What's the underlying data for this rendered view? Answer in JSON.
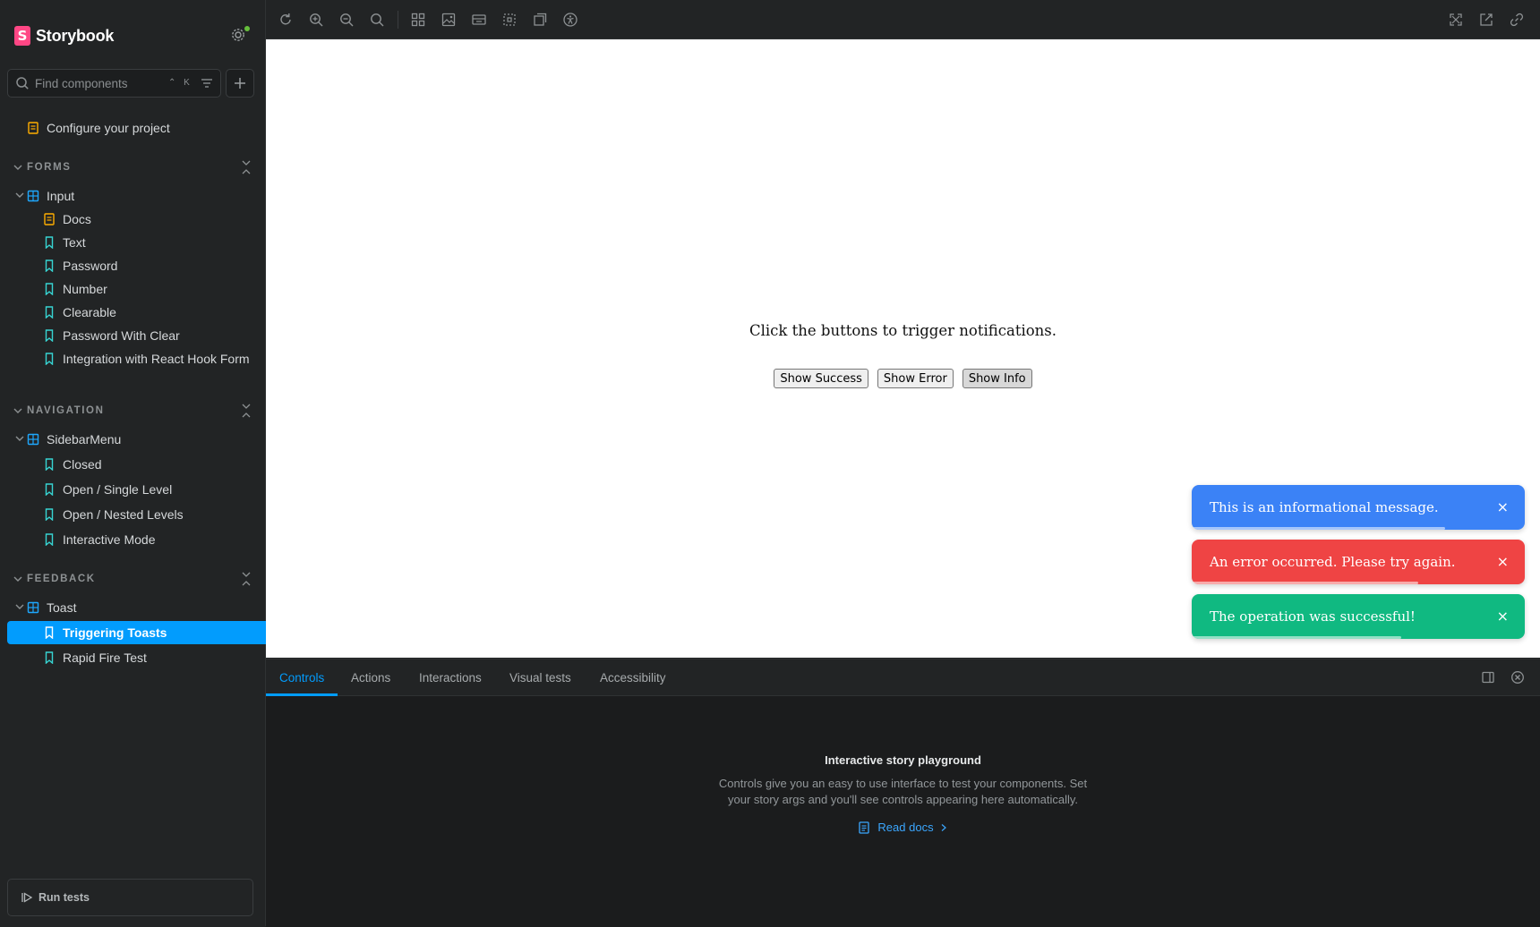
{
  "app": {
    "name": "Storybook"
  },
  "search": {
    "placeholder": "Find components",
    "shortcut": "⌃ K"
  },
  "sidebar": {
    "configure": "Configure your project",
    "sections": [
      {
        "title": "FORMS",
        "component": "Input",
        "items": [
          "Docs",
          "Text",
          "Password",
          "Number",
          "Clearable",
          "Password With Clear",
          "Integration with React Hook Form"
        ]
      },
      {
        "title": "NAVIGATION",
        "component": "SidebarMenu",
        "items": [
          "Closed",
          "Open / Single Level",
          "Open / Nested Levels",
          "Interactive Mode"
        ]
      },
      {
        "title": "FEEDBACK",
        "component": "Toast",
        "items": [
          "Triggering Toasts",
          "Rapid Fire Test"
        ]
      }
    ],
    "run_tests": "Run tests"
  },
  "preview": {
    "prompt": "Click the buttons to trigger notifications.",
    "buttons": [
      "Show Success",
      "Show Error",
      "Show Info"
    ],
    "toasts": [
      {
        "type": "info",
        "message": "This is an informational message.",
        "close": "×",
        "progress": 0.76
      },
      {
        "type": "error",
        "message": "An error occurred. Please try again.",
        "close": "×",
        "progress": 0.68
      },
      {
        "type": "success",
        "message": "The operation was successful!",
        "close": "×",
        "progress": 0.63
      }
    ]
  },
  "panel": {
    "tabs": [
      "Controls",
      "Actions",
      "Interactions",
      "Visual tests",
      "Accessibility"
    ],
    "active_tab": "Controls",
    "empty_title": "Interactive story playground",
    "empty_desc": "Controls give you an easy to use interface to test your components. Set your story args and you'll see controls appearing here automatically.",
    "read_docs": "Read docs"
  },
  "colors": {
    "accent": "#029cfd",
    "docs_icon": "#ffae00",
    "story_icon": "#37d5d3",
    "component_icon": "#1ea7fd",
    "toast_info": "#3b82f6",
    "toast_error": "#ef4444",
    "toast_success": "#10b981"
  }
}
